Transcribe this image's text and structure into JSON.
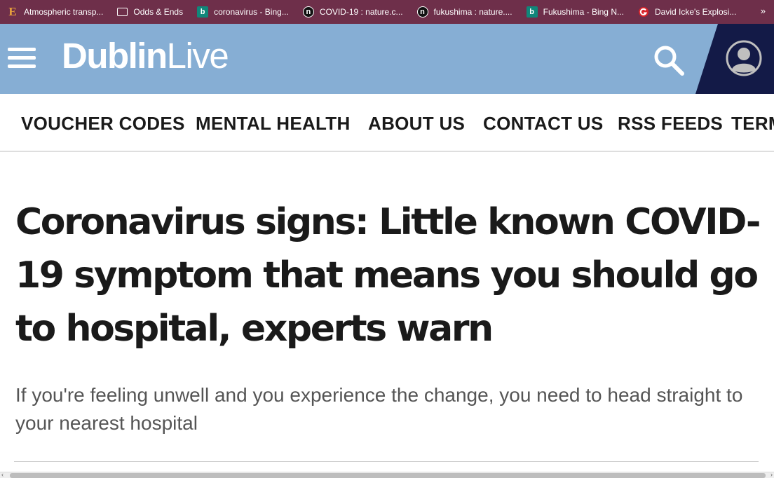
{
  "bookmarks": {
    "items": [
      {
        "label": "Atmospheric transp...",
        "icon": "e-letter-icon"
      },
      {
        "label": "Odds & Ends",
        "icon": "folder-icon"
      },
      {
        "label": "coronavirus - Bing...",
        "icon": "bing-icon"
      },
      {
        "label": "COVID-19 : nature.c...",
        "icon": "nature-icon"
      },
      {
        "label": "fukushima : nature....",
        "icon": "nature-icon"
      },
      {
        "label": "Fukushima - Bing N...",
        "icon": "bing-icon"
      },
      {
        "label": "David Icke's Explosi...",
        "icon": "red-circle-icon"
      }
    ],
    "icon_glyphs": {
      "e": "E",
      "bing": "b",
      "nature": "n"
    },
    "more": "»"
  },
  "header": {
    "logo_part1": "Dublin",
    "logo_part2": "Live",
    "background": "#86aed4",
    "account_background": "#131a47"
  },
  "nav": {
    "items": [
      "VOUCHER CODES",
      "MENTAL HEALTH",
      "ABOUT US",
      "CONTACT US",
      "RSS FEEDS",
      "TERM"
    ]
  },
  "article": {
    "headline": "Coronavirus signs: Little known COVID-19 symptom that means you should go to hospital, experts warn",
    "standfirst": "If you're feeling unwell and you experience the change, you need to head straight to your nearest hospital"
  },
  "scrollbar": {
    "left_arrow": "‹",
    "right_arrow": "›"
  }
}
